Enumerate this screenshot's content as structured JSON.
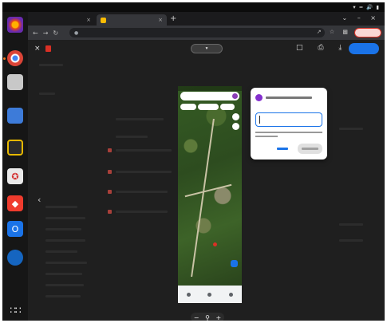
{
  "colors": {
    "ubuntu_orange": "#e8731c",
    "drive_blue": "#1a73e8",
    "image_red": "#d93025",
    "avatar_purple": "#8430ce"
  },
  "topbar": {
    "icons": [
      "chevron-down-icon",
      "network-icon",
      "volume-icon",
      "battery-icon",
      "power-icon"
    ]
  },
  "dock": {
    "icons": [
      "firefox-icon",
      "chrome-icon",
      "files-icon",
      "document-viewer-icon",
      "security-shield-icon",
      "pdf-icon",
      "anydesk-icon",
      "outlook-icon",
      "app-icon",
      "app-grid-icon"
    ]
  },
  "browser": {
    "toolbar_icons": [
      "back-icon",
      "forward-icon",
      "reload-icon",
      "share-icon",
      "star-icon",
      "extensions-icon",
      "profile-avatar-icon"
    ]
  },
  "viewer": {
    "toolbar_icons": [
      "close-icon",
      "add-comment-icon",
      "print-icon",
      "download-icon",
      "more-vert-icon"
    ]
  }
}
